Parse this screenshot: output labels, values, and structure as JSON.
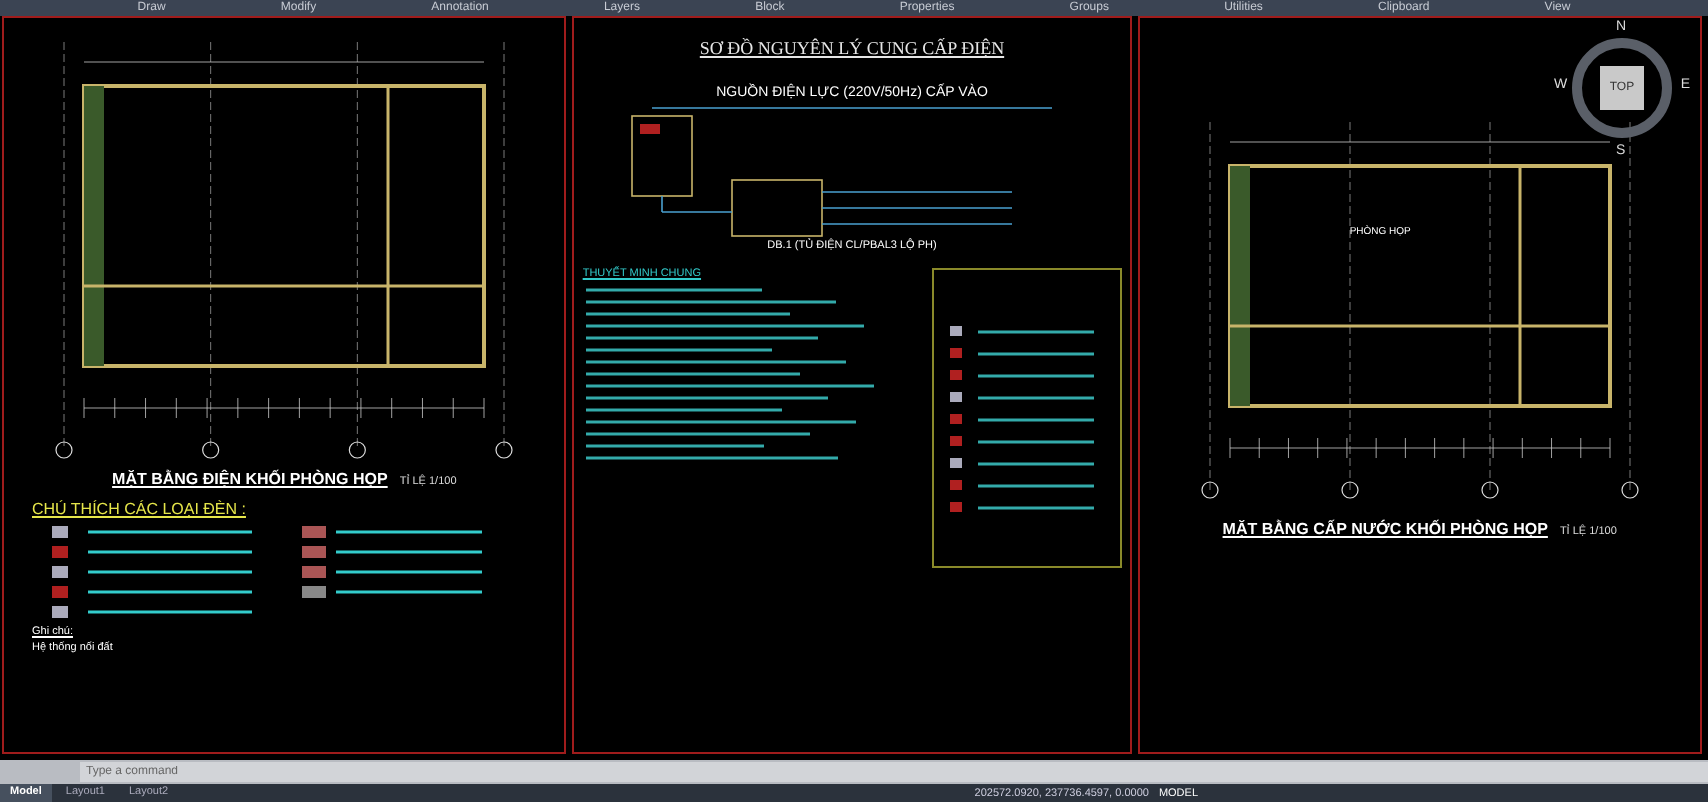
{
  "ribbon": {
    "panels": [
      "Draw",
      "Modify",
      "Annotation",
      "Layers",
      "Block",
      "Properties",
      "Groups",
      "Utilities",
      "Clipboard",
      "View"
    ]
  },
  "left_sheet": {
    "plan_title": "MẶT BẰNG ĐIỆN KHỐI PHÒNG HỌP",
    "scale": "TỈ LỆ 1/100",
    "legend_title": "CHÚ THÍCH CÁC LOẠI ĐÈN :",
    "notes_title": "Ghi chú:",
    "note": "Hệ thống nối đất"
  },
  "middle_sheet": {
    "title": "SƠ ĐỒ NGUYÊN LÝ CUNG CẤP ĐIỆN",
    "source_label": "NGUỒN ĐIỆN LỰC (220V/50Hz) CẤP VÀO",
    "panel_label": "DB.1 (TỦ ĐIỆN CL/PBAL3 LỘ PH)",
    "notes_title": "THUYẾT MINH CHUNG"
  },
  "right_sheet": {
    "plan_title": "MẶT BẰNG CẤP NƯỚC KHỐI PHÒNG HỌP",
    "scale": "TỈ LỆ 1/100",
    "room_label": "PHÒNG HỌP"
  },
  "viewcube": {
    "face": "TOP",
    "north": "N",
    "west": "W",
    "east": "E",
    "south": "S"
  },
  "command_line": {
    "placeholder": "Type a command"
  },
  "layout_tabs": [
    {
      "label": "Model",
      "selected": true
    },
    {
      "label": "Layout1",
      "selected": false
    },
    {
      "label": "Layout2",
      "selected": false
    }
  ],
  "status_bar": {
    "coordinates": "202572.0920, 237736.4597, 0.0000",
    "space": "MODEL"
  }
}
